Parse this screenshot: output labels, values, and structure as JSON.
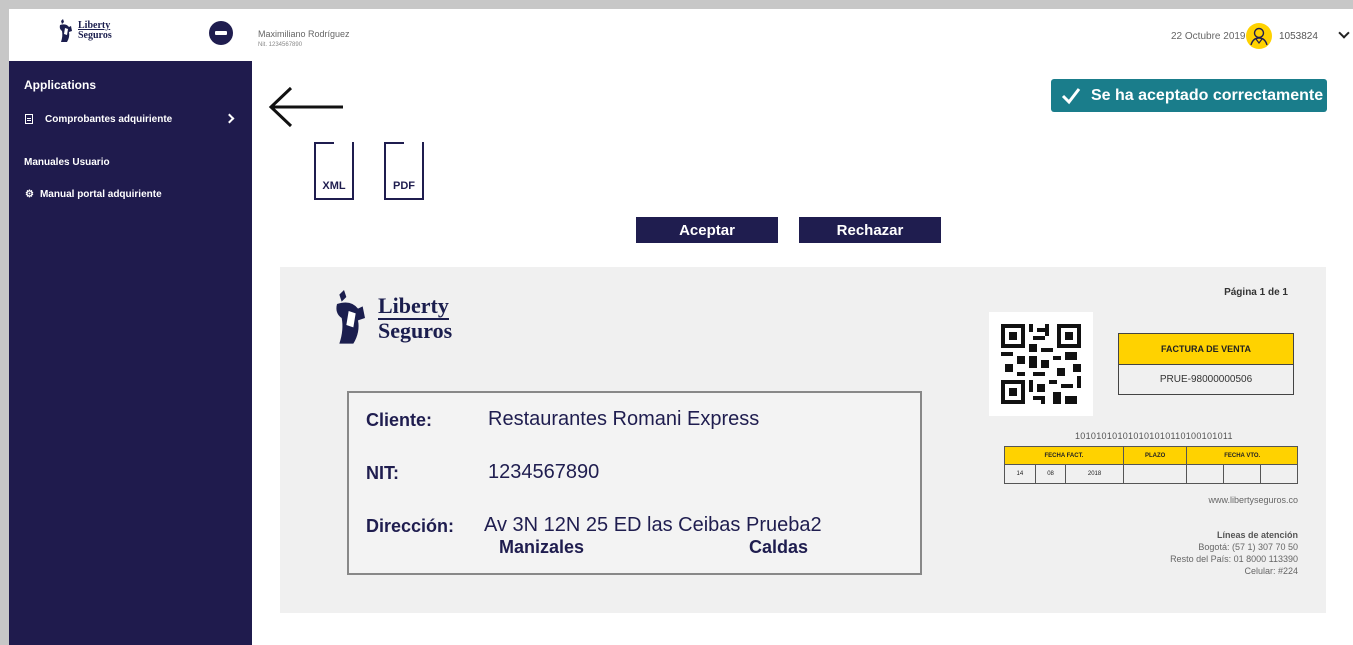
{
  "header": {
    "logo_line1": "Liberty",
    "logo_line2": "Seguros",
    "user_name": "Maximiliano Rodríguez",
    "user_nit": "Nit. 1234567890",
    "date": "22 Octubre 2019",
    "user_code": "1053824"
  },
  "sidebar": {
    "section_applications": "Applications",
    "item_comprobantes": "Comprobantes adquiriente",
    "section_manuales": "Manuales Usuario",
    "item_manual": "Manual portal adquiriente"
  },
  "toast": {
    "message": "Se ha aceptado correctamente"
  },
  "files": {
    "xml_label": "XML",
    "pdf_label": "PDF"
  },
  "actions": {
    "accept": "Aceptar",
    "reject": "Rechazar"
  },
  "invoice": {
    "logo_line1": "Liberty",
    "logo_line2": "Seguros",
    "page": "Página 1 de 1",
    "cliente_label": "Cliente:",
    "cliente_value": "Restaurantes Romani Express",
    "nit_label": "NIT:",
    "nit_value": "1234567890",
    "direccion_label": "Dirección:",
    "direccion_value": "Av 3N 12N 25 ED las Ceibas Prueba2",
    "ciudad": "Manizales",
    "departamento": "Caldas",
    "factura_title": "FACTURA DE VENTA",
    "factura_number": "PRUE-98000000506",
    "barcode_text": "101010101010101010110100101011",
    "table_headers": [
      "FECHA FACT.",
      "PLAZO",
      "FECHA VTO."
    ],
    "fecha_dia": "14",
    "fecha_mes": "08",
    "fecha_anio": "2018",
    "website": "www.libertyseguros.co",
    "lineas_title": "Líneas de atención",
    "lineas_bogota": "Bogotá: (57 1) 307 70 50",
    "lineas_resto": "Resto del País: 01 8000 113390",
    "lineas_celular": "Celular: #224"
  },
  "colors": {
    "navy": "#1f1d4f",
    "teal": "#1a7d8b",
    "yellow": "#ffd200"
  }
}
